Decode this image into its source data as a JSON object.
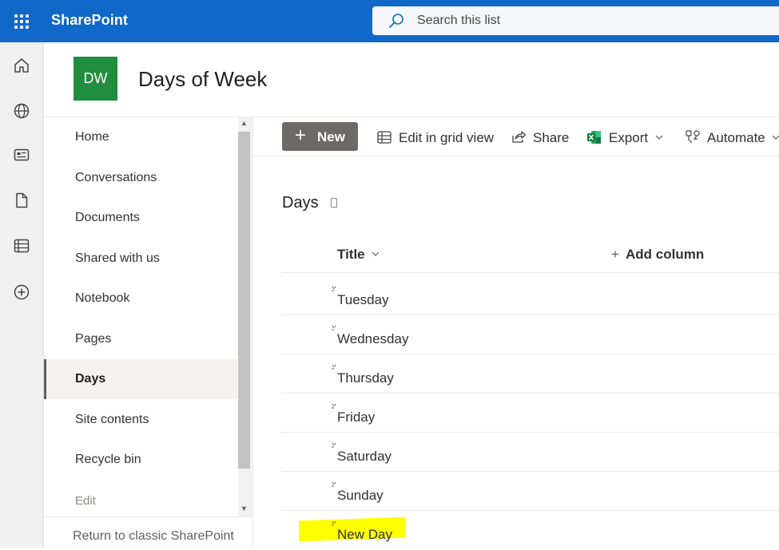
{
  "suite_bar": {
    "app_name": "SharePoint",
    "search_placeholder": "Search this list",
    "color": "#1068c8"
  },
  "app_bar": {
    "icons": [
      "home-icon",
      "globe-icon",
      "news-icon",
      "document-icon",
      "lists-icon",
      "create-icon"
    ]
  },
  "site": {
    "logo_initials": "DW",
    "logo_color": "#218d3f",
    "title": "Days of Week"
  },
  "left_nav": {
    "items": [
      {
        "label": "Home"
      },
      {
        "label": "Conversations"
      },
      {
        "label": "Documents"
      },
      {
        "label": "Shared with us"
      },
      {
        "label": "Notebook"
      },
      {
        "label": "Pages"
      },
      {
        "label": "Days",
        "selected": true
      },
      {
        "label": "Site contents"
      },
      {
        "label": "Recycle bin"
      }
    ],
    "edit_label": "Edit",
    "return_label": "Return to classic SharePoint"
  },
  "command_bar": {
    "new_label": "New",
    "edit_grid_label": "Edit in grid view",
    "share_label": "Share",
    "export_label": "Export",
    "automate_label": "Automate"
  },
  "list": {
    "title": "Days",
    "columns": {
      "title": "Title",
      "add_column": "Add column"
    },
    "rows": [
      {
        "title": "Tuesday"
      },
      {
        "title": "Wednesday"
      },
      {
        "title": "Thursday"
      },
      {
        "title": "Friday"
      },
      {
        "title": "Saturday"
      },
      {
        "title": "Sunday"
      },
      {
        "title": "New Day",
        "highlighted": true
      }
    ],
    "highlight_color": "#ffff00"
  }
}
